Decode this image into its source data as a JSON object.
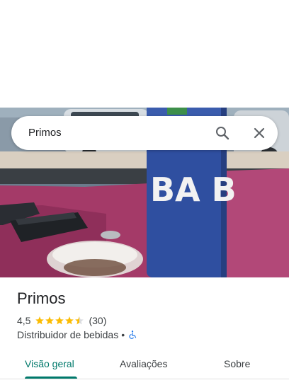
{
  "search": {
    "query": "Primos"
  },
  "place": {
    "name": "Primos",
    "rating": "4,5",
    "rating_fraction": 0.9,
    "review_count": "(30)",
    "category": "Distribuidor de bebidas",
    "separator": "•"
  },
  "tabs": [
    {
      "label": "Visão geral",
      "active": true
    },
    {
      "label": "Avaliações",
      "active": false
    },
    {
      "label": "Sobre",
      "active": false
    }
  ],
  "photo": {
    "bottle_text": "BA  B"
  },
  "colors": {
    "accent": "#00796b",
    "star": "#fbbc04",
    "text_secondary": "#3c4043",
    "wheelchair_icon": "#1a73e8"
  },
  "icons": {
    "search": "search-icon",
    "close": "close-icon",
    "star": "star-icon",
    "accessibility": "wheelchair-icon"
  }
}
